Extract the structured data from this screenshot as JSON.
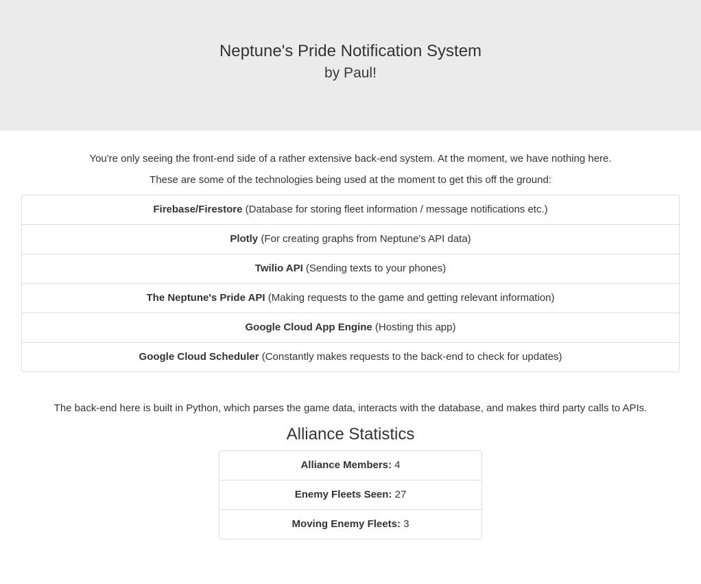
{
  "header": {
    "title": "Neptune's Pride Notification System",
    "subtitle": "by Paul!"
  },
  "intro": {
    "line1": "You're only seeing the front-end side of a rather extensive back-end system. At the moment, we have nothing here.",
    "line2": "These are some of the technologies being used at the moment to get this off the ground:"
  },
  "technologies": [
    {
      "name": "Firebase/Firestore",
      "description": " (Database for storing fleet information / message notifications etc.)"
    },
    {
      "name": "Plotly",
      "description": " (For creating graphs from Neptune's API data)"
    },
    {
      "name": "Twilio API",
      "description": " (Sending texts to your phones)"
    },
    {
      "name": "The Neptune's Pride API",
      "description": " (Making requests to the game and getting relevant information)"
    },
    {
      "name": "Google Cloud App Engine",
      "description": " (Hosting this app)"
    },
    {
      "name": "Google Cloud Scheduler",
      "description": " (Constantly makes requests to the back-end to check for updates)"
    }
  ],
  "backend": {
    "text": "The back-end here is built in Python, which parses the game data, interacts with the database, and makes third party calls to APIs."
  },
  "stats": {
    "title": "Alliance Statistics",
    "items": [
      {
        "label": "Alliance Members:",
        "value": " 4"
      },
      {
        "label": "Enemy Fleets Seen:",
        "value": " 27"
      },
      {
        "label": "Moving Enemy Fleets:",
        "value": " 3"
      }
    ]
  }
}
